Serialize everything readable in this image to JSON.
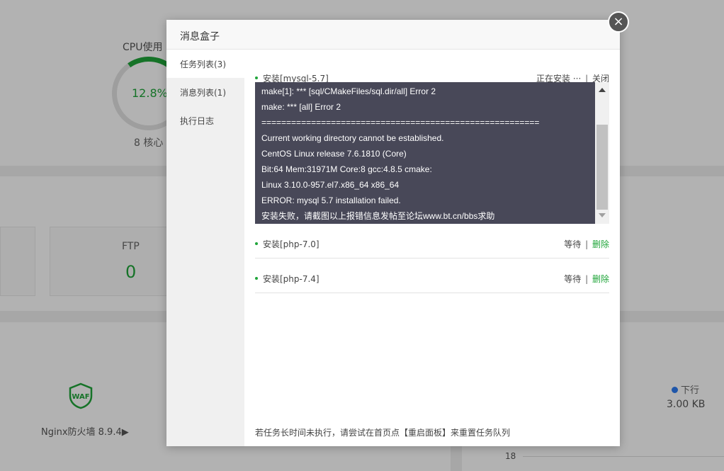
{
  "background": {
    "cpu_label": "CPU使用",
    "cpu_value": "12.8%",
    "cores": "8 核心",
    "ftp_label": "FTP",
    "ftp_value": "0",
    "waf_text": "WAF",
    "nginx_label": "Nginx防火墙 8.9.4▶",
    "download_label": "下行",
    "download_value": "3.00 KB",
    "axis_tick": "18"
  },
  "modal": {
    "title": "消息盒子",
    "close_symbol": "×",
    "sidebar": [
      {
        "label": "任务列表(3)",
        "active": true
      },
      {
        "label": "消息列表(1)",
        "active": false
      },
      {
        "label": "执行日志",
        "active": false
      }
    ],
    "tasks": [
      {
        "title": "安装[mysql-5.7]",
        "status": "正在安装 ···",
        "action": "关闭",
        "log": [
          "make[1]: *** [sql/CMakeFiles/sql.dir/all] Error 2",
          "make: *** [all] Error 2",
          "========================================================",
          "Current working directory cannot be established.",
          "CentOS Linux release 7.6.1810 (Core)",
          "Bit:64 Mem:31971M Core:8 gcc:4.8.5 cmake:",
          "Linux 3.10.0-957.el7.x86_64 x86_64",
          "ERROR: mysql 5.7 installation failed.",
          "安装失败，请截图以上报错信息发帖至论坛www.bt.cn/bbs求助"
        ]
      },
      {
        "title": "安装[php-7.0]",
        "status": "等待",
        "action": "删除"
      },
      {
        "title": "安装[php-7.4]",
        "status": "等待",
        "action": "删除"
      }
    ],
    "footer_note": "若任务长时间未执行，请尝试在首页点【重启面板】来重置任务队列"
  },
  "colors": {
    "accent_green": "#20a53a",
    "log_bg": "#484858",
    "download_blue": "#2d7bf2"
  }
}
